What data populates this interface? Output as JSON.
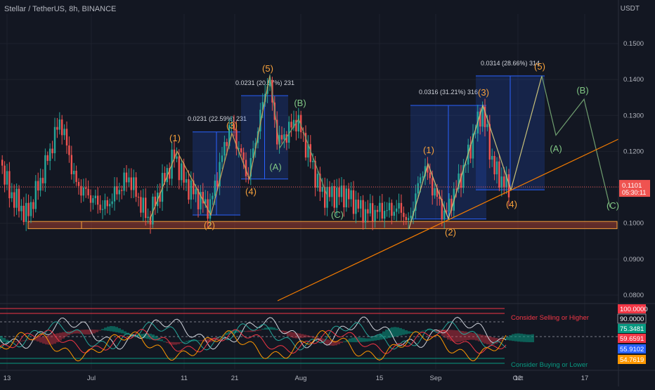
{
  "header": {
    "symbol": "Stellar / TetherUS, 8h, BINANCE",
    "currency": "USDT"
  },
  "chart_data": {
    "type": "line",
    "series_type": "candlestick",
    "x_ticks": [
      "13",
      "Jul",
      "11",
      "21",
      "Aug",
      "15",
      "Sep",
      "12",
      "Oct",
      "17"
    ],
    "y_ticks": [
      "0.1500",
      "0.1400",
      "0.1300",
      "0.1200",
      "0.1000",
      "0.0900",
      "0.0800"
    ],
    "ylim": [
      0.076,
      0.158
    ],
    "last_price": "0.1101",
    "countdown": "05:30:11",
    "colors": {
      "up": "#26a69a",
      "down": "#ef5350",
      "wave_impulse": "#f7a13b",
      "wave_corrective": "#81c784",
      "box_fill": "#1e3a8a",
      "box_line": "#2962ff"
    },
    "measurements": [
      {
        "label": "0.0231 (22.59%) 231"
      },
      {
        "label": "0.0231 (20.57%) 231"
      },
      {
        "label": "0.0316 (31.21%) 316"
      },
      {
        "label": "0.0314 (28.66%) 314"
      }
    ],
    "wave_labels_impulse": [
      "(1)",
      "(2)",
      "(3)",
      "(4)",
      "(5)",
      "(1)",
      "(2)",
      "(3)",
      "(4)",
      "(5)"
    ],
    "wave_labels_corrective": [
      "(A)",
      "(B)",
      "(C)",
      "(A)",
      "(B)",
      "(C)"
    ],
    "support_zone": [
      0.0985,
      0.1005
    ]
  },
  "oscillator": {
    "upper_note": "Consider Selling or Higher",
    "lower_note": "Consider Buying or Lower",
    "badges": [
      "100.0000",
      "90.0000",
      "75.3481",
      "59.6591",
      "55.9102",
      "54.7619"
    ],
    "badge_colors": [
      "#f23645",
      "#131722",
      "#089981",
      "#f23645",
      "#2962ff",
      "#ff9800"
    ]
  }
}
